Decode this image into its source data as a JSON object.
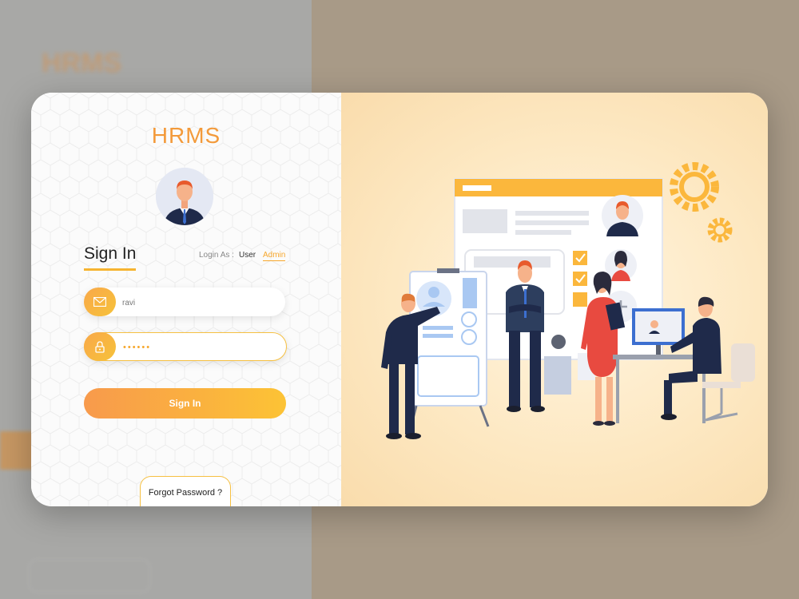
{
  "app": {
    "brand": "HRMS"
  },
  "login": {
    "title": "Sign In",
    "login_as_label": "Login As :",
    "roles": [
      {
        "label": "User",
        "selected": false
      },
      {
        "label": "Admin",
        "selected": true
      }
    ],
    "email": {
      "value": "ravi",
      "icon": "mail-icon"
    },
    "password": {
      "value": "••••••",
      "icon": "lock-icon"
    },
    "submit_label": "Sign In",
    "forgot_label": "Forgot Password ?"
  },
  "colors": {
    "accent": "#f6a72c",
    "gradient_start": "#f89a4c",
    "gradient_end": "#fcc335",
    "brand": "#f39a3a"
  }
}
